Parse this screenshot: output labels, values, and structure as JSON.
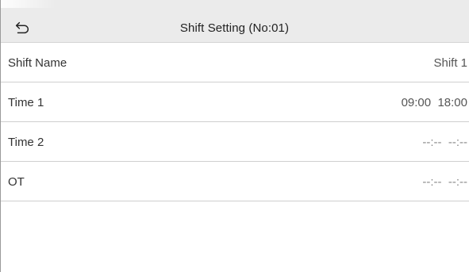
{
  "header": {
    "title": "Shift Setting (No:01)",
    "back_icon": "undo-arrow-icon"
  },
  "rows": [
    {
      "label": "Shift Name",
      "value": "Shift 1"
    },
    {
      "label": "Time 1",
      "value": "09:00  18:00"
    },
    {
      "label": "Time 2",
      "value": "--:--  --:--"
    },
    {
      "label": "OT",
      "value": "--:--  --:--"
    }
  ],
  "colors": {
    "header_bg": "#ebebeb",
    "divider": "#cfcfcf",
    "text": "#333333"
  }
}
